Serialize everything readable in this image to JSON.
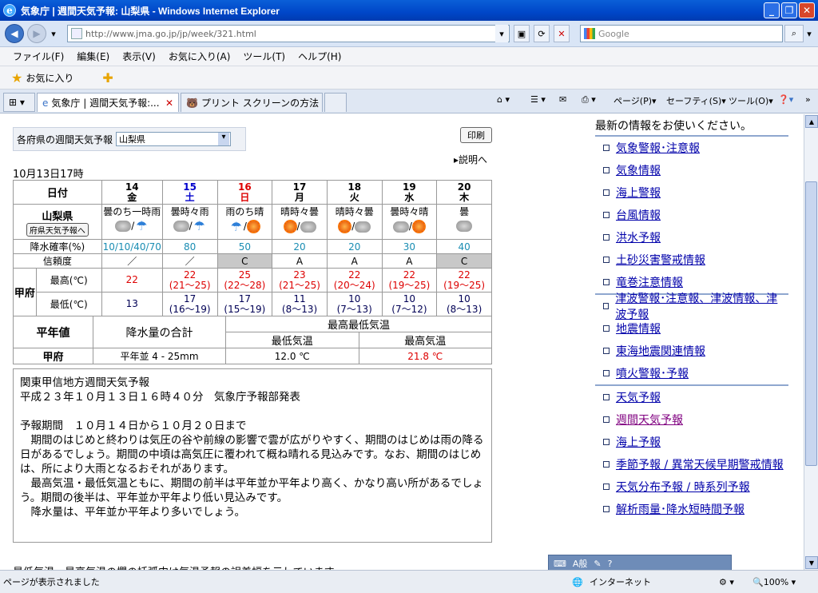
{
  "window": {
    "title": "気象庁 | 週間天気予報: 山梨県 - Windows Internet Explorer"
  },
  "address": {
    "url": "http://www.jma.go.jp/jp/week/321.html",
    "search_placeholder": "Google"
  },
  "menu": [
    "ファイル(F)",
    "編集(E)",
    "表示(V)",
    "お気に入り(A)",
    "ツール(T)",
    "ヘルプ(H)"
  ],
  "favorites": {
    "label": "お気に入り"
  },
  "tabs": [
    "気象庁 | 週間天気予報:...",
    "プリント スクリーンの方法"
  ],
  "tools": [
    "ページ(P)",
    "セーフティ(S)",
    "ツール(O)"
  ],
  "page": {
    "header_cut": "最新の情報をお使いください。",
    "pref_label": "各府県の週間天気予報",
    "pref_value": "山梨県",
    "print": "印刷",
    "explain": "説明へ",
    "issued": "10月13日17時",
    "table": {
      "date_header": "日付",
      "region": "山梨県",
      "region_btn": "府県天気予報へ",
      "days": [
        {
          "d": "14",
          "w": "金"
        },
        {
          "d": "15",
          "w": "土"
        },
        {
          "d": "16",
          "w": "日"
        },
        {
          "d": "17",
          "w": "月"
        },
        {
          "d": "18",
          "w": "火"
        },
        {
          "d": "19",
          "w": "水"
        },
        {
          "d": "20",
          "w": "木"
        }
      ],
      "weather": [
        "曇のち一時雨",
        "曇時々雨",
        "雨のち晴",
        "晴時々曇",
        "晴時々曇",
        "曇時々晴",
        "曇"
      ],
      "precip_label": "降水確率(%)",
      "precip": [
        "10/10/40/70",
        "80",
        "50",
        "20",
        "20",
        "30",
        "40"
      ],
      "rel_label": "信頼度",
      "rel": [
        "／",
        "／",
        "C",
        "A",
        "A",
        "A",
        "C"
      ],
      "city": "甲府",
      "max_label": "最高(℃)",
      "min_label": "最低(℃)",
      "max": [
        "22",
        "22",
        "25",
        "23",
        "22",
        "22",
        "22"
      ],
      "max_range": [
        "",
        "(21～25)",
        "(22～28)",
        "(21～25)",
        "(20～24)",
        "(19～25)",
        "(19～25)"
      ],
      "min": [
        "13",
        "17",
        "17",
        "11",
        "10",
        "10",
        "10"
      ],
      "min_range": [
        "",
        "(16～19)",
        "(15～19)",
        "(8～13)",
        "(7～13)",
        "(7～12)",
        "(8～13)"
      ]
    },
    "normals": {
      "h1": "平年値",
      "h2": "降水量の合計",
      "h3": "最高最低気温",
      "h4": "最低気温",
      "h5": "最高気温",
      "city": "甲府",
      "rain": "平年並 4 - 25mm",
      "min": "12.0 ℃",
      "max": "21.8 ℃"
    },
    "forecast": {
      "l1": "関東甲信地方週間天気予報",
      "l2": "平成２３年１０月１３日１６時４０分　気象庁予報部発表",
      "l3": "予報期間　１０月１４日から１０月２０日まで",
      "l4": "　期間のはじめと終わりは気圧の谷や前線の影響で雲が広がりやすく、期間のはじめは雨の降る日があるでしょう。期間の中頃は高気圧に覆われて概ね晴れる見込みです。なお、期間のはじめは、所により大雨となるおそれがあります。",
      "l5": "　最高気温・最低気温ともに、期間の前半は平年並か平年より高く、かなり高い所があるでしょう。期間の後半は、平年並か平年より低い見込みです。",
      "l6": "　降水量は、平年並か平年より多いでしょう。",
      "bottom": "最低気温、最高気温の欄の括弧内は気温予報の誤差幅を示しています。"
    },
    "side": [
      [
        "気象警報･注意報",
        "気象情報",
        "海上警報",
        "台風情報",
        "洪水予報",
        "土砂災害警戒情報",
        "竜巻注意情報"
      ],
      [
        "津波警報･注意報、津波情報、津波予報",
        "地震情報",
        "東海地震関連情報",
        "噴火警報･予報"
      ],
      [
        "天気予報",
        "週間天気予報",
        "海上予報",
        "季節予報 / 異常天候早期警戒情報",
        "天気分布予報 / 時系列予報",
        "解析雨量･降水短時間予報"
      ]
    ]
  },
  "status": {
    "left": "ページが表示されました",
    "zone": "インターネット",
    "zoom": "100%"
  }
}
